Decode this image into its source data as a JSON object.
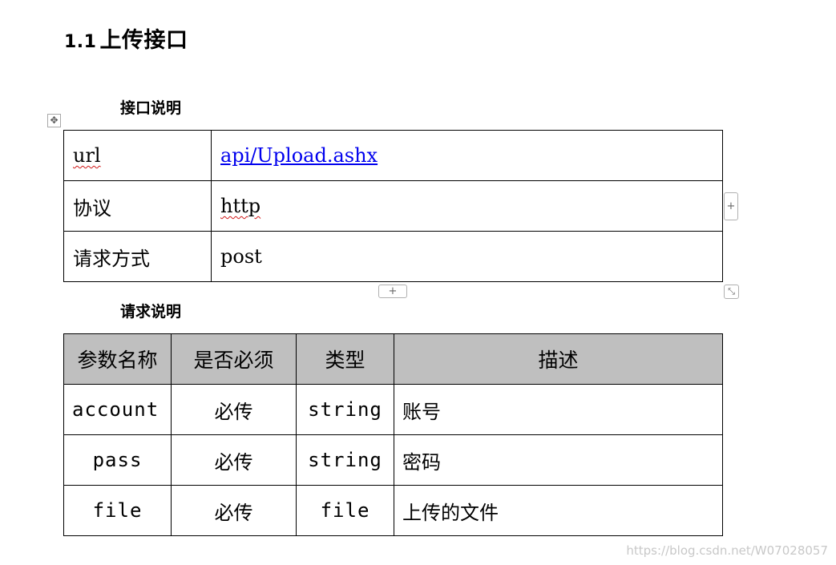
{
  "section": {
    "number": "1.1",
    "title": "上传接口"
  },
  "interface_title": "接口说明",
  "interface_rows": [
    {
      "key": "url",
      "value": "api/Upload.ashx"
    },
    {
      "key": "协议",
      "value": "http"
    },
    {
      "key": "请求方式",
      "value": "post"
    }
  ],
  "request_title": "请求说明",
  "request_table": {
    "headers": [
      "参数名称",
      "是否必须",
      "类型",
      "描述"
    ],
    "rows": [
      {
        "name": "account",
        "required": "必传",
        "type": "string",
        "desc": "账号"
      },
      {
        "name": "pass",
        "required": "必传",
        "type": "string",
        "desc": "密码"
      },
      {
        "name": "file",
        "required": "必传",
        "type": "file",
        "desc": "上传的文件"
      }
    ]
  },
  "icons": {
    "move": "move-arrows-icon",
    "add_column": "plus-icon",
    "add_row": "plus-icon",
    "resize": "resize-diagonal-icon"
  },
  "watermark": "https://blog.csdn.net/W07028057",
  "colors": {
    "link": "#0000ee",
    "header_bg": "#bfbfbf",
    "spell_error": "#d01818"
  }
}
